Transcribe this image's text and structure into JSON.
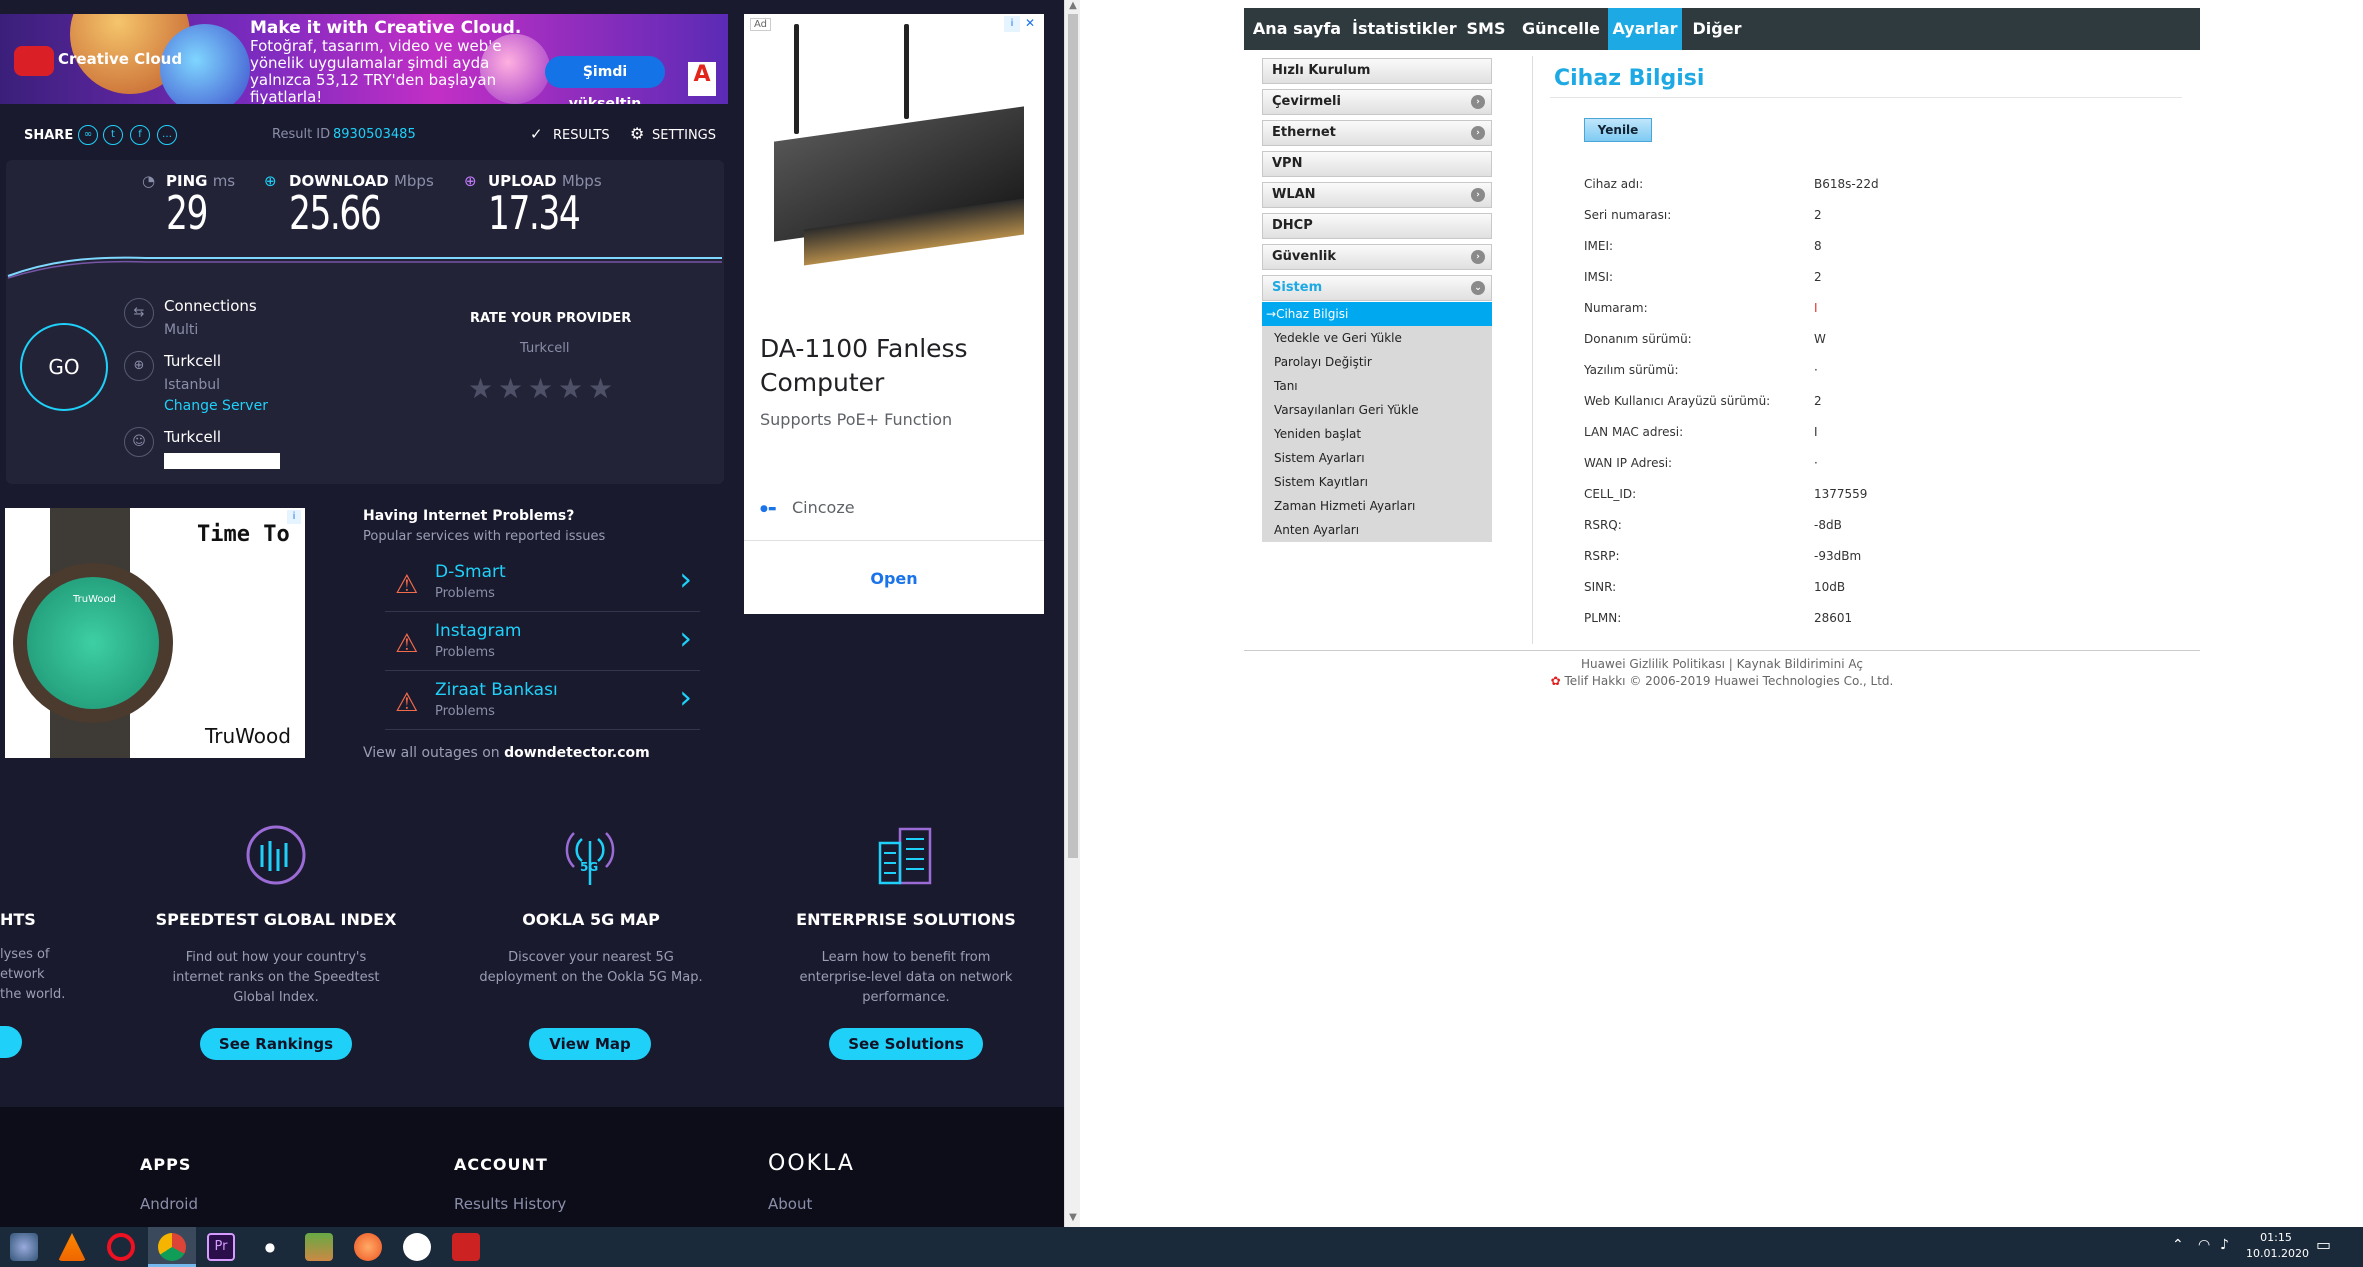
{
  "ad_top": {
    "brand": "Creative Cloud",
    "headline": "Make it with Creative Cloud.",
    "body": "Fotoğraf, tasarım, video ve web'e yönelik uygulamalar şimdi ayda yalnızca 53,12 TRY'den başlayan fiyatlarla!",
    "cta": "Şimdi yükseltin",
    "adobe": "Adobe"
  },
  "speedtest": {
    "share_label": "SHARE",
    "result_id_label": "Result ID",
    "result_id": "8930503485",
    "results_label": "RESULTS",
    "settings_label": "SETTINGS",
    "ping_label": "PING",
    "ping_unit": "ms",
    "ping_value": "29",
    "download_label": "DOWNLOAD",
    "download_unit": "Mbps",
    "download_value": "25.66",
    "upload_label": "UPLOAD",
    "upload_unit": "Mbps",
    "upload_value": "17.34",
    "go_label": "GO",
    "connections_label": "Connections",
    "connections_value": "Multi",
    "server_name": "Turkcell",
    "server_city": "Istanbul",
    "change_server": "Change Server",
    "provider_name": "Turkcell",
    "rate_label": "RATE YOUR PROVIDER",
    "rate_provider": "Turkcell",
    "stars": 5
  },
  "watch_ad": {
    "title": "Time To",
    "dial_brand": "TruWood",
    "brand": "TruWood"
  },
  "problems": {
    "title": "Having Internet Problems?",
    "subtitle": "Popular services with reported issues",
    "items": [
      {
        "name": "D-Smart",
        "status": "Problems"
      },
      {
        "name": "Instagram",
        "status": "Problems"
      },
      {
        "name": "Ziraat Bankası",
        "status": "Problems"
      }
    ],
    "view_all": "View all outages on",
    "link": "downdetector.com"
  },
  "pc_ad": {
    "ad_tag": "Ad",
    "title": "DA-1100 Fanless Computer",
    "subtitle": "Supports PoE+ Function",
    "advertiser": "Cincoze",
    "open": "Open"
  },
  "features": {
    "partial_title": "HTS",
    "partial_desc": [
      "lyses of",
      "etwork",
      "the world."
    ],
    "items": [
      {
        "title": "SPEEDTEST GLOBAL INDEX",
        "desc": "Find out how your country's internet ranks on the Speedtest Global Index.",
        "button": "See Rankings"
      },
      {
        "title": "OOKLA 5G MAP",
        "desc": "Discover your nearest 5G deployment on the Ookla 5G Map.",
        "button": "View Map"
      },
      {
        "title": "ENTERPRISE SOLUTIONS",
        "desc": "Learn how to benefit from enterprise-level data on network performance.",
        "button": "See Solutions"
      }
    ],
    "fiveg_label": "5G"
  },
  "footer": {
    "apps": "APPS",
    "apps_link": "Android",
    "account": "ACCOUNT",
    "account_link": "Results History",
    "ookla": "OOKLA",
    "ookla_link": "About"
  },
  "router": {
    "nav": [
      "Ana sayfa",
      "İstatistikler",
      "SMS",
      "Güncelle",
      "Ayarlar",
      "Diğer"
    ],
    "menu": [
      {
        "label": "Hızlı Kurulum",
        "chev": false
      },
      {
        "label": "Çevirmeli",
        "chev": true
      },
      {
        "label": "Ethernet",
        "chev": true
      },
      {
        "label": "VPN",
        "chev": false
      },
      {
        "label": "WLAN",
        "chev": true
      },
      {
        "label": "DHCP",
        "chev": false
      },
      {
        "label": "Güvenlik",
        "chev": true
      }
    ],
    "sistem": "Sistem",
    "submenu": [
      "Cihaz Bilgisi",
      "Yedekle ve Geri Yükle",
      "Parolayı Değiştir",
      "Tanı",
      "Varsayılanları Geri Yükle",
      "Yeniden başlat",
      "Sistem Ayarları",
      "Sistem Kayıtları",
      "Zaman Hizmeti Ayarları",
      "Anten Ayarları"
    ],
    "page_title": "Cihaz Bilgisi",
    "refresh": "Yenile",
    "fields": [
      {
        "k": "Cihaz adı:",
        "v": "B618s-22d"
      },
      {
        "k": "Seri numarası:",
        "v": "2"
      },
      {
        "k": "IMEI:",
        "v": "8"
      },
      {
        "k": "IMSI:",
        "v": "2"
      },
      {
        "k": "Numaram:",
        "v": "I"
      },
      {
        "k": "Donanım sürümü:",
        "v": "W"
      },
      {
        "k": "Yazılım sürümü:",
        "v": "·"
      },
      {
        "k": "Web Kullanıcı Arayüzü sürümü:",
        "v": "2"
      },
      {
        "k": "LAN MAC adresi:",
        "v": "I"
      },
      {
        "k": "WAN IP Adresi:",
        "v": "·"
      },
      {
        "k": "CELL_ID:",
        "v": "1377559"
      },
      {
        "k": "RSRQ:",
        "v": "-8dB"
      },
      {
        "k": "RSRP:",
        "v": "-93dBm"
      },
      {
        "k": "SINR:",
        "v": "10dB"
      },
      {
        "k": "PLMN:",
        "v": "28601"
      }
    ],
    "footer_privacy": "Huawei Gizlilik Politikası",
    "footer_sep": "|",
    "footer_source": "Kaynak Bildirimini Aç",
    "copyright": "Telif Hakkı © 2006-2019 Huawei Technologies Co., Ltd."
  },
  "taskbar": {
    "time": "01:15",
    "date": "10.01.2020"
  }
}
